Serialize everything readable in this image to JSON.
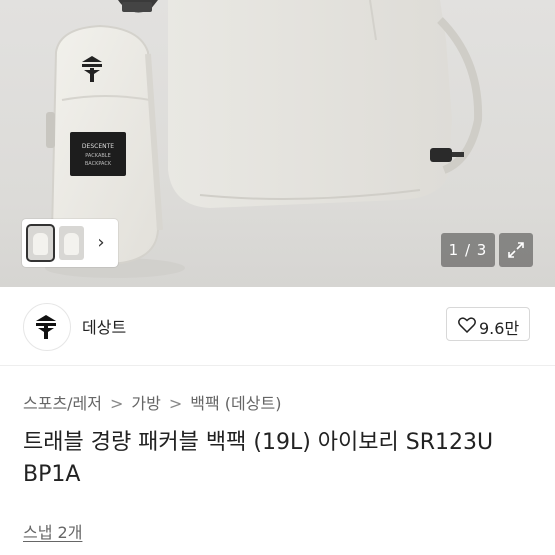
{
  "gallery": {
    "counter": "1 / 3",
    "brand_label_lines": [
      "DESCENTE",
      "PACKABLE",
      "BACKPACK"
    ],
    "thumbnail_count": 2
  },
  "shop": {
    "name": "데상트",
    "like_count": "9.6만"
  },
  "breadcrumb": {
    "items": [
      "스포츠/레저",
      "가방",
      "백팩 (데상트)"
    ],
    "separator": ">"
  },
  "product": {
    "title": "트래블 경량 패커블 백팩 (19L) 아이보리 SR123U BP1A"
  },
  "snap": {
    "label": "스냅 2개"
  },
  "colors": {
    "bag": "#ecebe6",
    "background": "#dddcd9"
  }
}
